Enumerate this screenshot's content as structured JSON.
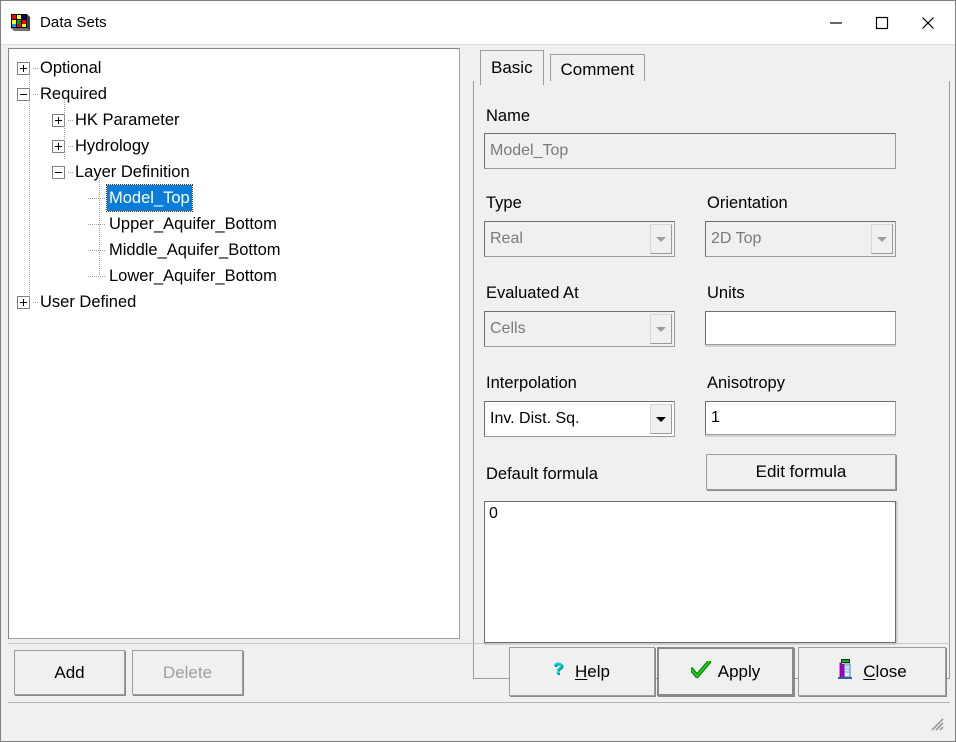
{
  "window": {
    "title": "Data Sets",
    "icon": "datasets-cube-icon",
    "minimize_label": "—",
    "maximize_label": "☐",
    "close_label": "✕"
  },
  "tree": {
    "nodes": [
      {
        "label": "Optional",
        "depth": 0,
        "expander": "plus",
        "selected": false
      },
      {
        "label": "Required",
        "depth": 0,
        "expander": "minus",
        "selected": false
      },
      {
        "label": "HK Parameter",
        "depth": 1,
        "expander": "plus",
        "selected": false
      },
      {
        "label": "Hydrology",
        "depth": 1,
        "expander": "plus",
        "selected": false
      },
      {
        "label": "Layer Definition",
        "depth": 1,
        "expander": "minus",
        "selected": false
      },
      {
        "label": "Model_Top",
        "depth": 2,
        "expander": "none",
        "selected": true
      },
      {
        "label": "Upper_Aquifer_Bottom",
        "depth": 2,
        "expander": "none",
        "selected": false
      },
      {
        "label": "Middle_Aquifer_Bottom",
        "depth": 2,
        "expander": "none",
        "selected": false
      },
      {
        "label": "Lower_Aquifer_Bottom",
        "depth": 2,
        "expander": "none",
        "selected": false
      },
      {
        "label": "User Defined",
        "depth": 0,
        "expander": "plus",
        "selected": false
      }
    ]
  },
  "tabs": [
    {
      "label": "Basic",
      "active": true
    },
    {
      "label": "Comment",
      "active": false
    }
  ],
  "form": {
    "name_label": "Name",
    "name_value": "Model_Top",
    "name_enabled": false,
    "type_label": "Type",
    "type_value": "Real",
    "type_enabled": false,
    "orientation_label": "Orientation",
    "orientation_value": "2D Top",
    "orientation_enabled": false,
    "evaluated_at_label": "Evaluated At",
    "evaluated_at_value": "Cells",
    "evaluated_at_enabled": false,
    "units_label": "Units",
    "units_value": "",
    "units_placeholder": "",
    "interpolation_label": "Interpolation",
    "interpolation_value": "Inv. Dist. Sq.",
    "interpolation_enabled": true,
    "anisotropy_label": "Anisotropy",
    "anisotropy_value": "1",
    "default_formula_label": "Default formula",
    "edit_formula_label": "Edit formula",
    "formula_value": "0"
  },
  "footer": {
    "add_label": "Add",
    "delete_label": "Delete",
    "delete_enabled": false,
    "help_label": "Help",
    "help_accel": "H",
    "help_icon": "question-mark-icon",
    "apply_label": "Apply",
    "apply_icon": "green-check-icon",
    "close_label": "Close",
    "close_accel": "C",
    "close_icon": "exit-door-icon"
  },
  "colors": {
    "selection_blue": "#0a7ddb",
    "panel_grey": "#f0f0f0",
    "field_white": "#ffffff",
    "disabled_text": "#7a7a7a",
    "help_teal": "#00a0a0",
    "apply_green": "#00a000",
    "close_purple": "#a000c0"
  },
  "statusbar": {
    "text": ""
  }
}
